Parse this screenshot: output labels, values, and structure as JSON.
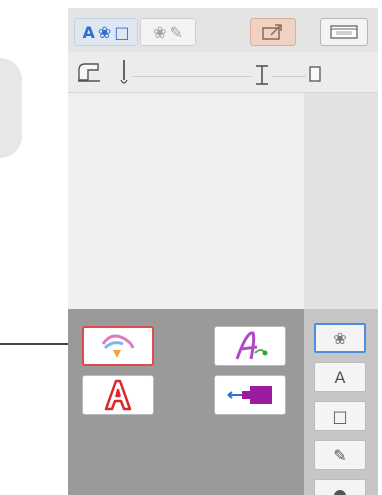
{
  "toolbar": {
    "mode_tab_text": {
      "a": "A",
      "flower": "❀",
      "square": "□"
    },
    "edit_tab_text": {
      "flower": "❀",
      "pencil": "✎"
    }
  },
  "panel": {
    "side_buttons": [
      {
        "name": "pattern",
        "glyph": "❀"
      },
      {
        "name": "text",
        "glyph": "A"
      },
      {
        "name": "frame",
        "glyph": "□"
      },
      {
        "name": "edit",
        "glyph": "✎"
      }
    ]
  },
  "colors": {
    "accent_blue": "#2f6fd1",
    "selection_red": "#e04a4a",
    "text_red": "#d8282c",
    "thread_purple": "#9a1aa0",
    "panel_dark": "#9a9a9a"
  }
}
